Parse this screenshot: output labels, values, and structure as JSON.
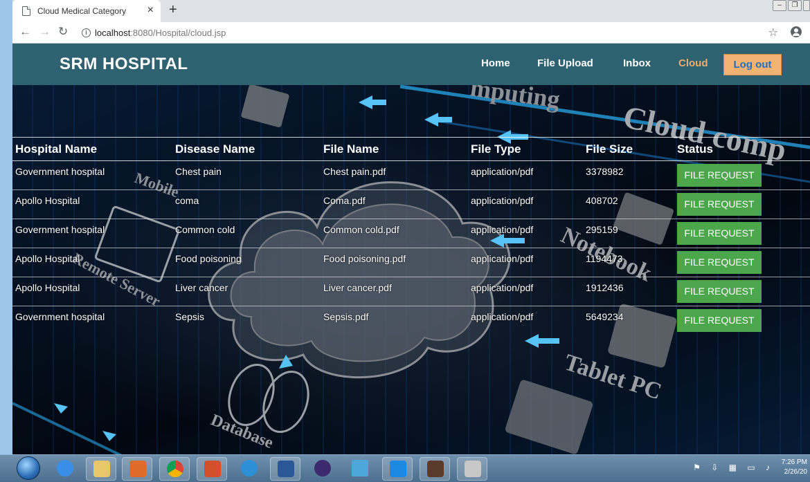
{
  "browser": {
    "tab_title": "Cloud Medical Category",
    "url_host": "localhost",
    "url_rest": ":8080/Hospital/cloud.jsp"
  },
  "header": {
    "brand": "SRM HOSPITAL",
    "nav": [
      {
        "label": "Home",
        "active": false
      },
      {
        "label": "File Upload",
        "active": false
      },
      {
        "label": "Inbox",
        "active": false
      },
      {
        "label": "Cloud",
        "active": true
      }
    ],
    "logout": "Log out"
  },
  "table": {
    "columns": [
      "Hospital Name",
      "Disease Name",
      "File Name",
      "File Type",
      "File Size",
      "Status"
    ],
    "rows": [
      {
        "hospital": "Government hospital",
        "disease": "Chest pain",
        "file": "Chest pain.pdf",
        "type": "application/pdf",
        "size": "3378982",
        "action": "FILE REQUEST"
      },
      {
        "hospital": "Apollo Hospital",
        "disease": "coma",
        "file": "Coma.pdf",
        "type": "application/pdf",
        "size": "408702",
        "action": "FILE REQUEST"
      },
      {
        "hospital": "Government hospital",
        "disease": "Common cold",
        "file": "Common cold.pdf",
        "type": "application/pdf",
        "size": "295159",
        "action": "FILE REQUEST"
      },
      {
        "hospital": "Apollo Hospital",
        "disease": "Food poisoning",
        "file": "Food poisoning.pdf",
        "type": "application/pdf",
        "size": "1194473",
        "action": "FILE REQUEST"
      },
      {
        "hospital": "Apollo Hospital",
        "disease": "Liver cancer",
        "file": "Liver cancer.pdf",
        "type": "application/pdf",
        "size": "1912436",
        "action": "FILE REQUEST"
      },
      {
        "hospital": "Government hospital",
        "disease": "Sepsis",
        "file": "Sepsis.pdf",
        "type": "application/pdf",
        "size": "5649234",
        "action": "FILE REQUEST"
      }
    ]
  },
  "background_text": {
    "cloud_computing": "Cloud comp",
    "computing": "mputing",
    "notebook": "Notebook",
    "tablet": "Tablet PC",
    "database": "Database",
    "remote_server": "Remote Server",
    "mobile": "Mobile"
  },
  "taskbar": {
    "time": "7:26 PM",
    "date": "2/26/20"
  },
  "colors": {
    "header_bg": "#2f6270",
    "active_nav": "#f0ad6e",
    "logout_bg": "#f4b273",
    "request_button": "#4ca64c"
  }
}
